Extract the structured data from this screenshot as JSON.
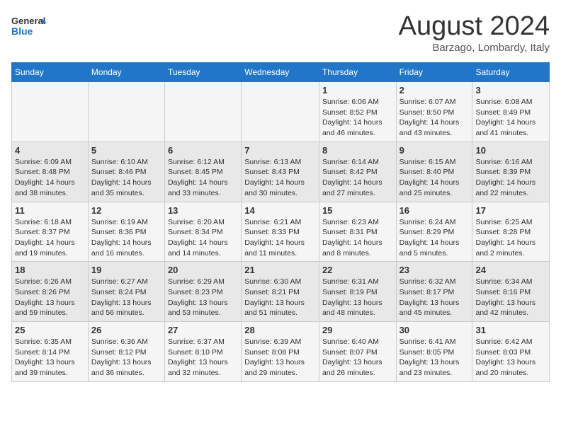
{
  "header": {
    "logo_line1": "General",
    "logo_line2": "Blue",
    "month_title": "August 2024",
    "location": "Barzago, Lombardy, Italy"
  },
  "weekdays": [
    "Sunday",
    "Monday",
    "Tuesday",
    "Wednesday",
    "Thursday",
    "Friday",
    "Saturday"
  ],
  "weeks": [
    [
      {
        "day": "",
        "info": ""
      },
      {
        "day": "",
        "info": ""
      },
      {
        "day": "",
        "info": ""
      },
      {
        "day": "",
        "info": ""
      },
      {
        "day": "1",
        "info": "Sunrise: 6:06 AM\nSunset: 8:52 PM\nDaylight: 14 hours and 46 minutes."
      },
      {
        "day": "2",
        "info": "Sunrise: 6:07 AM\nSunset: 8:50 PM\nDaylight: 14 hours and 43 minutes."
      },
      {
        "day": "3",
        "info": "Sunrise: 6:08 AM\nSunset: 8:49 PM\nDaylight: 14 hours and 41 minutes."
      }
    ],
    [
      {
        "day": "4",
        "info": "Sunrise: 6:09 AM\nSunset: 8:48 PM\nDaylight: 14 hours and 38 minutes."
      },
      {
        "day": "5",
        "info": "Sunrise: 6:10 AM\nSunset: 8:46 PM\nDaylight: 14 hours and 35 minutes."
      },
      {
        "day": "6",
        "info": "Sunrise: 6:12 AM\nSunset: 8:45 PM\nDaylight: 14 hours and 33 minutes."
      },
      {
        "day": "7",
        "info": "Sunrise: 6:13 AM\nSunset: 8:43 PM\nDaylight: 14 hours and 30 minutes."
      },
      {
        "day": "8",
        "info": "Sunrise: 6:14 AM\nSunset: 8:42 PM\nDaylight: 14 hours and 27 minutes."
      },
      {
        "day": "9",
        "info": "Sunrise: 6:15 AM\nSunset: 8:40 PM\nDaylight: 14 hours and 25 minutes."
      },
      {
        "day": "10",
        "info": "Sunrise: 6:16 AM\nSunset: 8:39 PM\nDaylight: 14 hours and 22 minutes."
      }
    ],
    [
      {
        "day": "11",
        "info": "Sunrise: 6:18 AM\nSunset: 8:37 PM\nDaylight: 14 hours and 19 minutes."
      },
      {
        "day": "12",
        "info": "Sunrise: 6:19 AM\nSunset: 8:36 PM\nDaylight: 14 hours and 16 minutes."
      },
      {
        "day": "13",
        "info": "Sunrise: 6:20 AM\nSunset: 8:34 PM\nDaylight: 14 hours and 14 minutes."
      },
      {
        "day": "14",
        "info": "Sunrise: 6:21 AM\nSunset: 8:33 PM\nDaylight: 14 hours and 11 minutes."
      },
      {
        "day": "15",
        "info": "Sunrise: 6:23 AM\nSunset: 8:31 PM\nDaylight: 14 hours and 8 minutes."
      },
      {
        "day": "16",
        "info": "Sunrise: 6:24 AM\nSunset: 8:29 PM\nDaylight: 14 hours and 5 minutes."
      },
      {
        "day": "17",
        "info": "Sunrise: 6:25 AM\nSunset: 8:28 PM\nDaylight: 14 hours and 2 minutes."
      }
    ],
    [
      {
        "day": "18",
        "info": "Sunrise: 6:26 AM\nSunset: 8:26 PM\nDaylight: 13 hours and 59 minutes."
      },
      {
        "day": "19",
        "info": "Sunrise: 6:27 AM\nSunset: 8:24 PM\nDaylight: 13 hours and 56 minutes."
      },
      {
        "day": "20",
        "info": "Sunrise: 6:29 AM\nSunset: 8:23 PM\nDaylight: 13 hours and 53 minutes."
      },
      {
        "day": "21",
        "info": "Sunrise: 6:30 AM\nSunset: 8:21 PM\nDaylight: 13 hours and 51 minutes."
      },
      {
        "day": "22",
        "info": "Sunrise: 6:31 AM\nSunset: 8:19 PM\nDaylight: 13 hours and 48 minutes."
      },
      {
        "day": "23",
        "info": "Sunrise: 6:32 AM\nSunset: 8:17 PM\nDaylight: 13 hours and 45 minutes."
      },
      {
        "day": "24",
        "info": "Sunrise: 6:34 AM\nSunset: 8:16 PM\nDaylight: 13 hours and 42 minutes."
      }
    ],
    [
      {
        "day": "25",
        "info": "Sunrise: 6:35 AM\nSunset: 8:14 PM\nDaylight: 13 hours and 39 minutes."
      },
      {
        "day": "26",
        "info": "Sunrise: 6:36 AM\nSunset: 8:12 PM\nDaylight: 13 hours and 36 minutes."
      },
      {
        "day": "27",
        "info": "Sunrise: 6:37 AM\nSunset: 8:10 PM\nDaylight: 13 hours and 32 minutes."
      },
      {
        "day": "28",
        "info": "Sunrise: 6:39 AM\nSunset: 8:08 PM\nDaylight: 13 hours and 29 minutes."
      },
      {
        "day": "29",
        "info": "Sunrise: 6:40 AM\nSunset: 8:07 PM\nDaylight: 13 hours and 26 minutes."
      },
      {
        "day": "30",
        "info": "Sunrise: 6:41 AM\nSunset: 8:05 PM\nDaylight: 13 hours and 23 minutes."
      },
      {
        "day": "31",
        "info": "Sunrise: 6:42 AM\nSunset: 8:03 PM\nDaylight: 13 hours and 20 minutes."
      }
    ]
  ]
}
